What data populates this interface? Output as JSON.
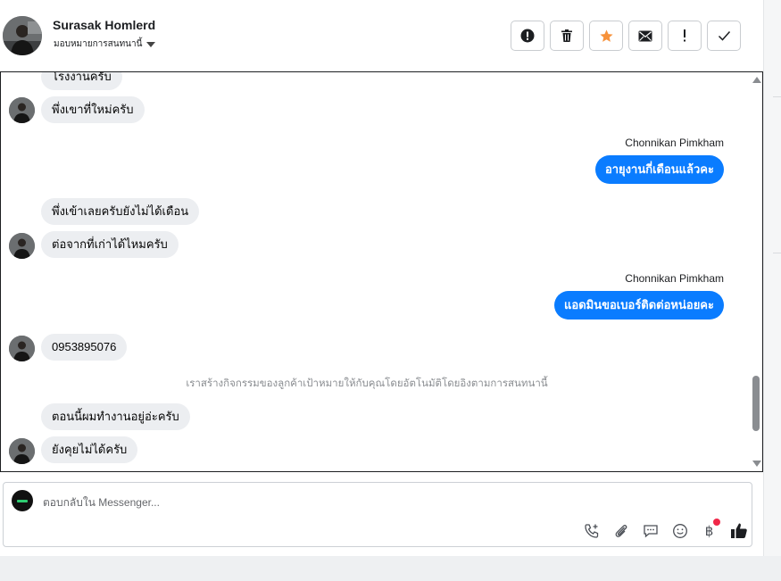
{
  "header": {
    "contact_name": "Surasak Homlerd",
    "assign_label": "มอบหมายการสนทนานี้",
    "actions": [
      {
        "name": "spam-button",
        "icon": "alert-circle-icon"
      },
      {
        "name": "delete-button",
        "icon": "trash-icon"
      },
      {
        "name": "star-button",
        "icon": "star-icon"
      },
      {
        "name": "mark-unread-button",
        "icon": "envelope-icon"
      },
      {
        "name": "follow-up-button",
        "icon": "exclamation-icon"
      },
      {
        "name": "mark-done-button",
        "icon": "check-icon"
      }
    ],
    "star_color": "#f7923b"
  },
  "messages": {
    "m1": "โรงงานครับ",
    "m2": "พึ่งเขาที่ใหม่ครับ",
    "sender1": "Chonnikan Pimkham",
    "m3": "อายุงานกี่เดือนแล้วคะ",
    "m4": "พึ่งเข้าเลยครับยังไม่ได้เดือน",
    "m5": "ต่อจากที่เก่าได้ไหมครับ",
    "sender2": "Chonnikan Pimkham",
    "m6": "แอดมินขอเบอร์ติดต่อหน่อยคะ",
    "m7": "0953895076",
    "system_note": "เราสร้างกิจกรรมของลูกค้าเป้าหมายให้กับคุณโดยอัตโนมัติโดยอิงตามการสนทนานี้",
    "m8": "ตอนนี้ผมทำงานอยู่อ่ะครับ",
    "m9": "ยังคุยไม่ได้ครับ"
  },
  "composer": {
    "placeholder": "ตอบกลับใน Messenger...",
    "tools": [
      "call-add-icon",
      "paperclip-icon",
      "saved-reply-icon",
      "emoji-icon",
      "baht-payment-icon",
      "thumbs-up-icon"
    ]
  },
  "colors": {
    "outgoing_bubble": "#0a7cff",
    "incoming_bubble": "#eceef1",
    "notification_dot": "#f02849"
  }
}
